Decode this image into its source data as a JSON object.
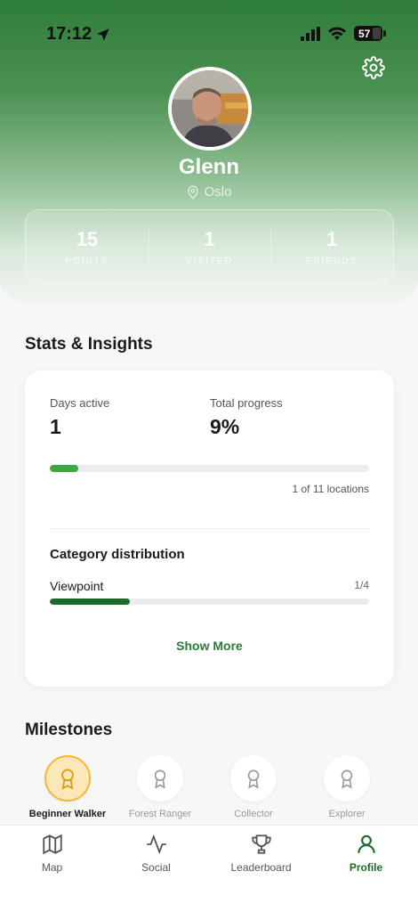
{
  "status_bar": {
    "time": "17:12",
    "battery": "57"
  },
  "profile": {
    "name": "Glenn",
    "location": "Oslo"
  },
  "stats": [
    {
      "value": "15",
      "label": "POINTS"
    },
    {
      "value": "1",
      "label": "VISITED"
    },
    {
      "value": "1",
      "label": "FRIENDS"
    }
  ],
  "insights": {
    "title": "Stats & Insights",
    "days_active_label": "Days active",
    "days_active_value": "1",
    "total_progress_label": "Total progress",
    "total_progress_value": "9%",
    "progress_fraction": 0.09,
    "progress_caption": "1 of 11 locations",
    "category_title": "Category distribution",
    "categories": [
      {
        "name": "Viewpoint",
        "count": "1/4",
        "fraction": 0.25
      }
    ],
    "show_more": "Show More"
  },
  "milestones": {
    "title": "Milestones",
    "items": [
      {
        "label": "Beginner Walker",
        "achieved": true
      },
      {
        "label": "Forest Ranger",
        "achieved": false
      },
      {
        "label": "Collector",
        "achieved": false
      },
      {
        "label": "Explorer",
        "achieved": false
      }
    ]
  },
  "tabs": [
    {
      "label": "Map",
      "icon": "map-icon",
      "active": false
    },
    {
      "label": "Social",
      "icon": "activity-icon",
      "active": false
    },
    {
      "label": "Leaderboard",
      "icon": "trophy-icon",
      "active": false
    },
    {
      "label": "Profile",
      "icon": "person-icon",
      "active": true
    }
  ],
  "colors": {
    "brand_green": "#2f7d3a",
    "progress_green": "#3ba746",
    "category_green": "#1f6a2b",
    "badge_gold": "#f2b935"
  }
}
